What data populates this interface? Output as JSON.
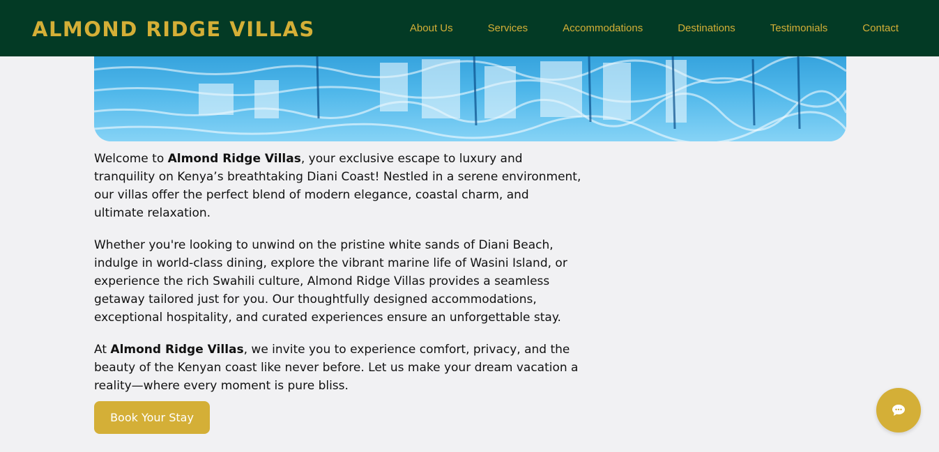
{
  "header": {
    "brand": "ALMOND RIDGE VILLAS",
    "nav": [
      {
        "label": "About Us"
      },
      {
        "label": "Services"
      },
      {
        "label": "Accommodations"
      },
      {
        "label": "Destinations"
      },
      {
        "label": "Testimonials"
      },
      {
        "label": "Contact"
      }
    ]
  },
  "intro": {
    "p1_prefix": "Welcome to ",
    "p1_brand": "Almond Ridge Villas",
    "p1_suffix": ", your exclusive escape to luxury and tranquility on Kenya’s breathtaking Diani Coast! Nestled in a serene environment, our villas offer the perfect blend of modern elegance, coastal charm, and ultimate relaxation.",
    "p2": "Whether you're looking to unwind on the pristine white sands of Diani Beach, indulge in world-class dining, explore the vibrant marine life of Wasini Island, or experience the rich Swahili culture, Almond Ridge Villas provides a seamless getaway tailored just for you. Our thoughtfully designed accommodations, exceptional hospitality, and curated experiences ensure an unforgettable stay.",
    "p3_prefix": "At ",
    "p3_brand": "Almond Ridge Villas",
    "p3_suffix": ", we invite you to experience comfort, privacy, and the beauty of the Kenyan coast like never before. Let us make your dream vacation a reality—where every moment is pure bliss."
  },
  "cta": {
    "book_label": "Book Your Stay"
  },
  "colors": {
    "nav_bg": "#033a25",
    "accent_gold": "#d4af37",
    "page_bg": "#f1f1f3"
  },
  "icons": {
    "chat": "chat-bubble-icon"
  }
}
